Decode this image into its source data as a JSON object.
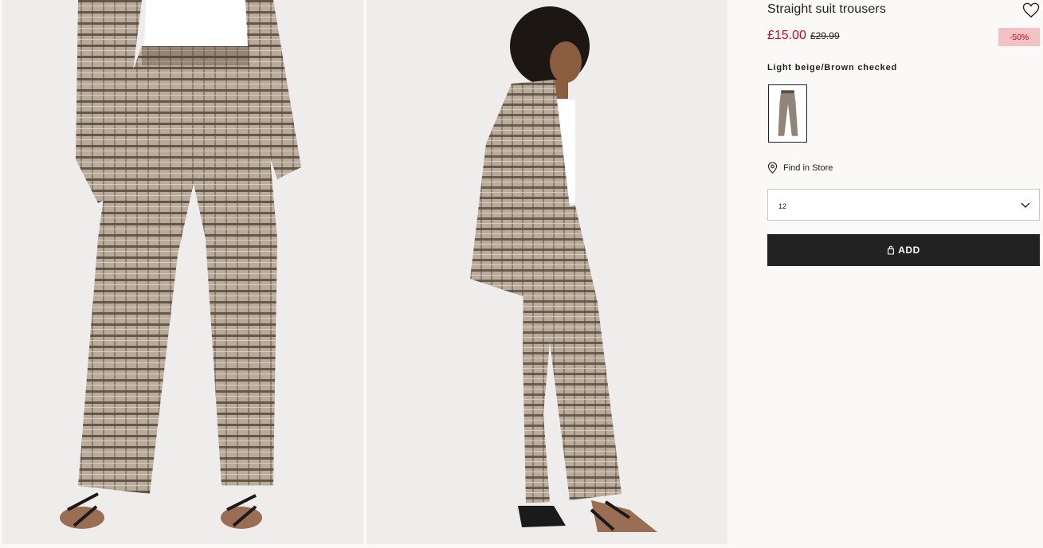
{
  "product": {
    "title": "Straight suit trousers",
    "price_now": "£15.00",
    "price_old": "£29.99",
    "discount_badge": "-50%",
    "color_name": "Light beige/Brown checked"
  },
  "store": {
    "label": "Find in Store"
  },
  "size": {
    "selected": "12"
  },
  "cart": {
    "add_label": "ADD"
  },
  "colors": {
    "sale": "#d0021b",
    "badge_bg": "#f3c2c4",
    "button_bg": "#222222",
    "background": "#faf9f8"
  },
  "icons": [
    "heart-icon",
    "location-pin-icon",
    "chevron-down-icon",
    "bag-icon"
  ]
}
